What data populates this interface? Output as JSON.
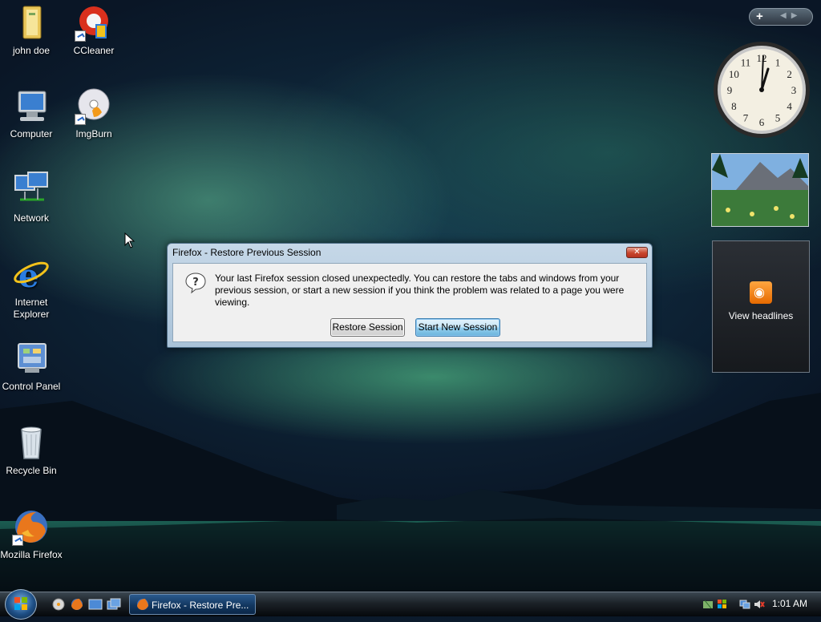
{
  "desktop": {
    "icons": [
      {
        "label": "john doe",
        "icon": "user-folder-icon"
      },
      {
        "label": "CCleaner",
        "icon": "ccleaner-icon"
      },
      {
        "label": "Computer",
        "icon": "computer-icon"
      },
      {
        "label": "ImgBurn",
        "icon": "imgburn-icon"
      },
      {
        "label": "Network",
        "icon": "network-icon"
      },
      {
        "label": "Internet Explorer",
        "icon": "internet-explorer-icon"
      },
      {
        "label": "Control Panel",
        "icon": "control-panel-icon"
      },
      {
        "label": "Recycle Bin",
        "icon": "recycle-bin-icon"
      },
      {
        "label": "Mozilla Firefox",
        "icon": "firefox-icon"
      }
    ]
  },
  "sidebar": {
    "add_label": "+",
    "clock_numbers": [
      "12",
      "1",
      "2",
      "3",
      "4",
      "5",
      "6",
      "7",
      "8",
      "9",
      "10",
      "11"
    ],
    "feed": {
      "label": "View headlines",
      "icon": "rss-icon"
    }
  },
  "dialog": {
    "title": "Firefox - Restore Previous Session",
    "close_glyph": "✕",
    "message": "Your last Firefox session closed unexpectedly. You can restore the tabs and windows from your previous session, or start a new session if you think the problem was related to a page you were viewing.",
    "restore_label": "Restore Session",
    "new_session_label": "Start New Session"
  },
  "taskbar": {
    "task_label": "Firefox - Restore Pre...",
    "clock": "1:01 AM"
  }
}
